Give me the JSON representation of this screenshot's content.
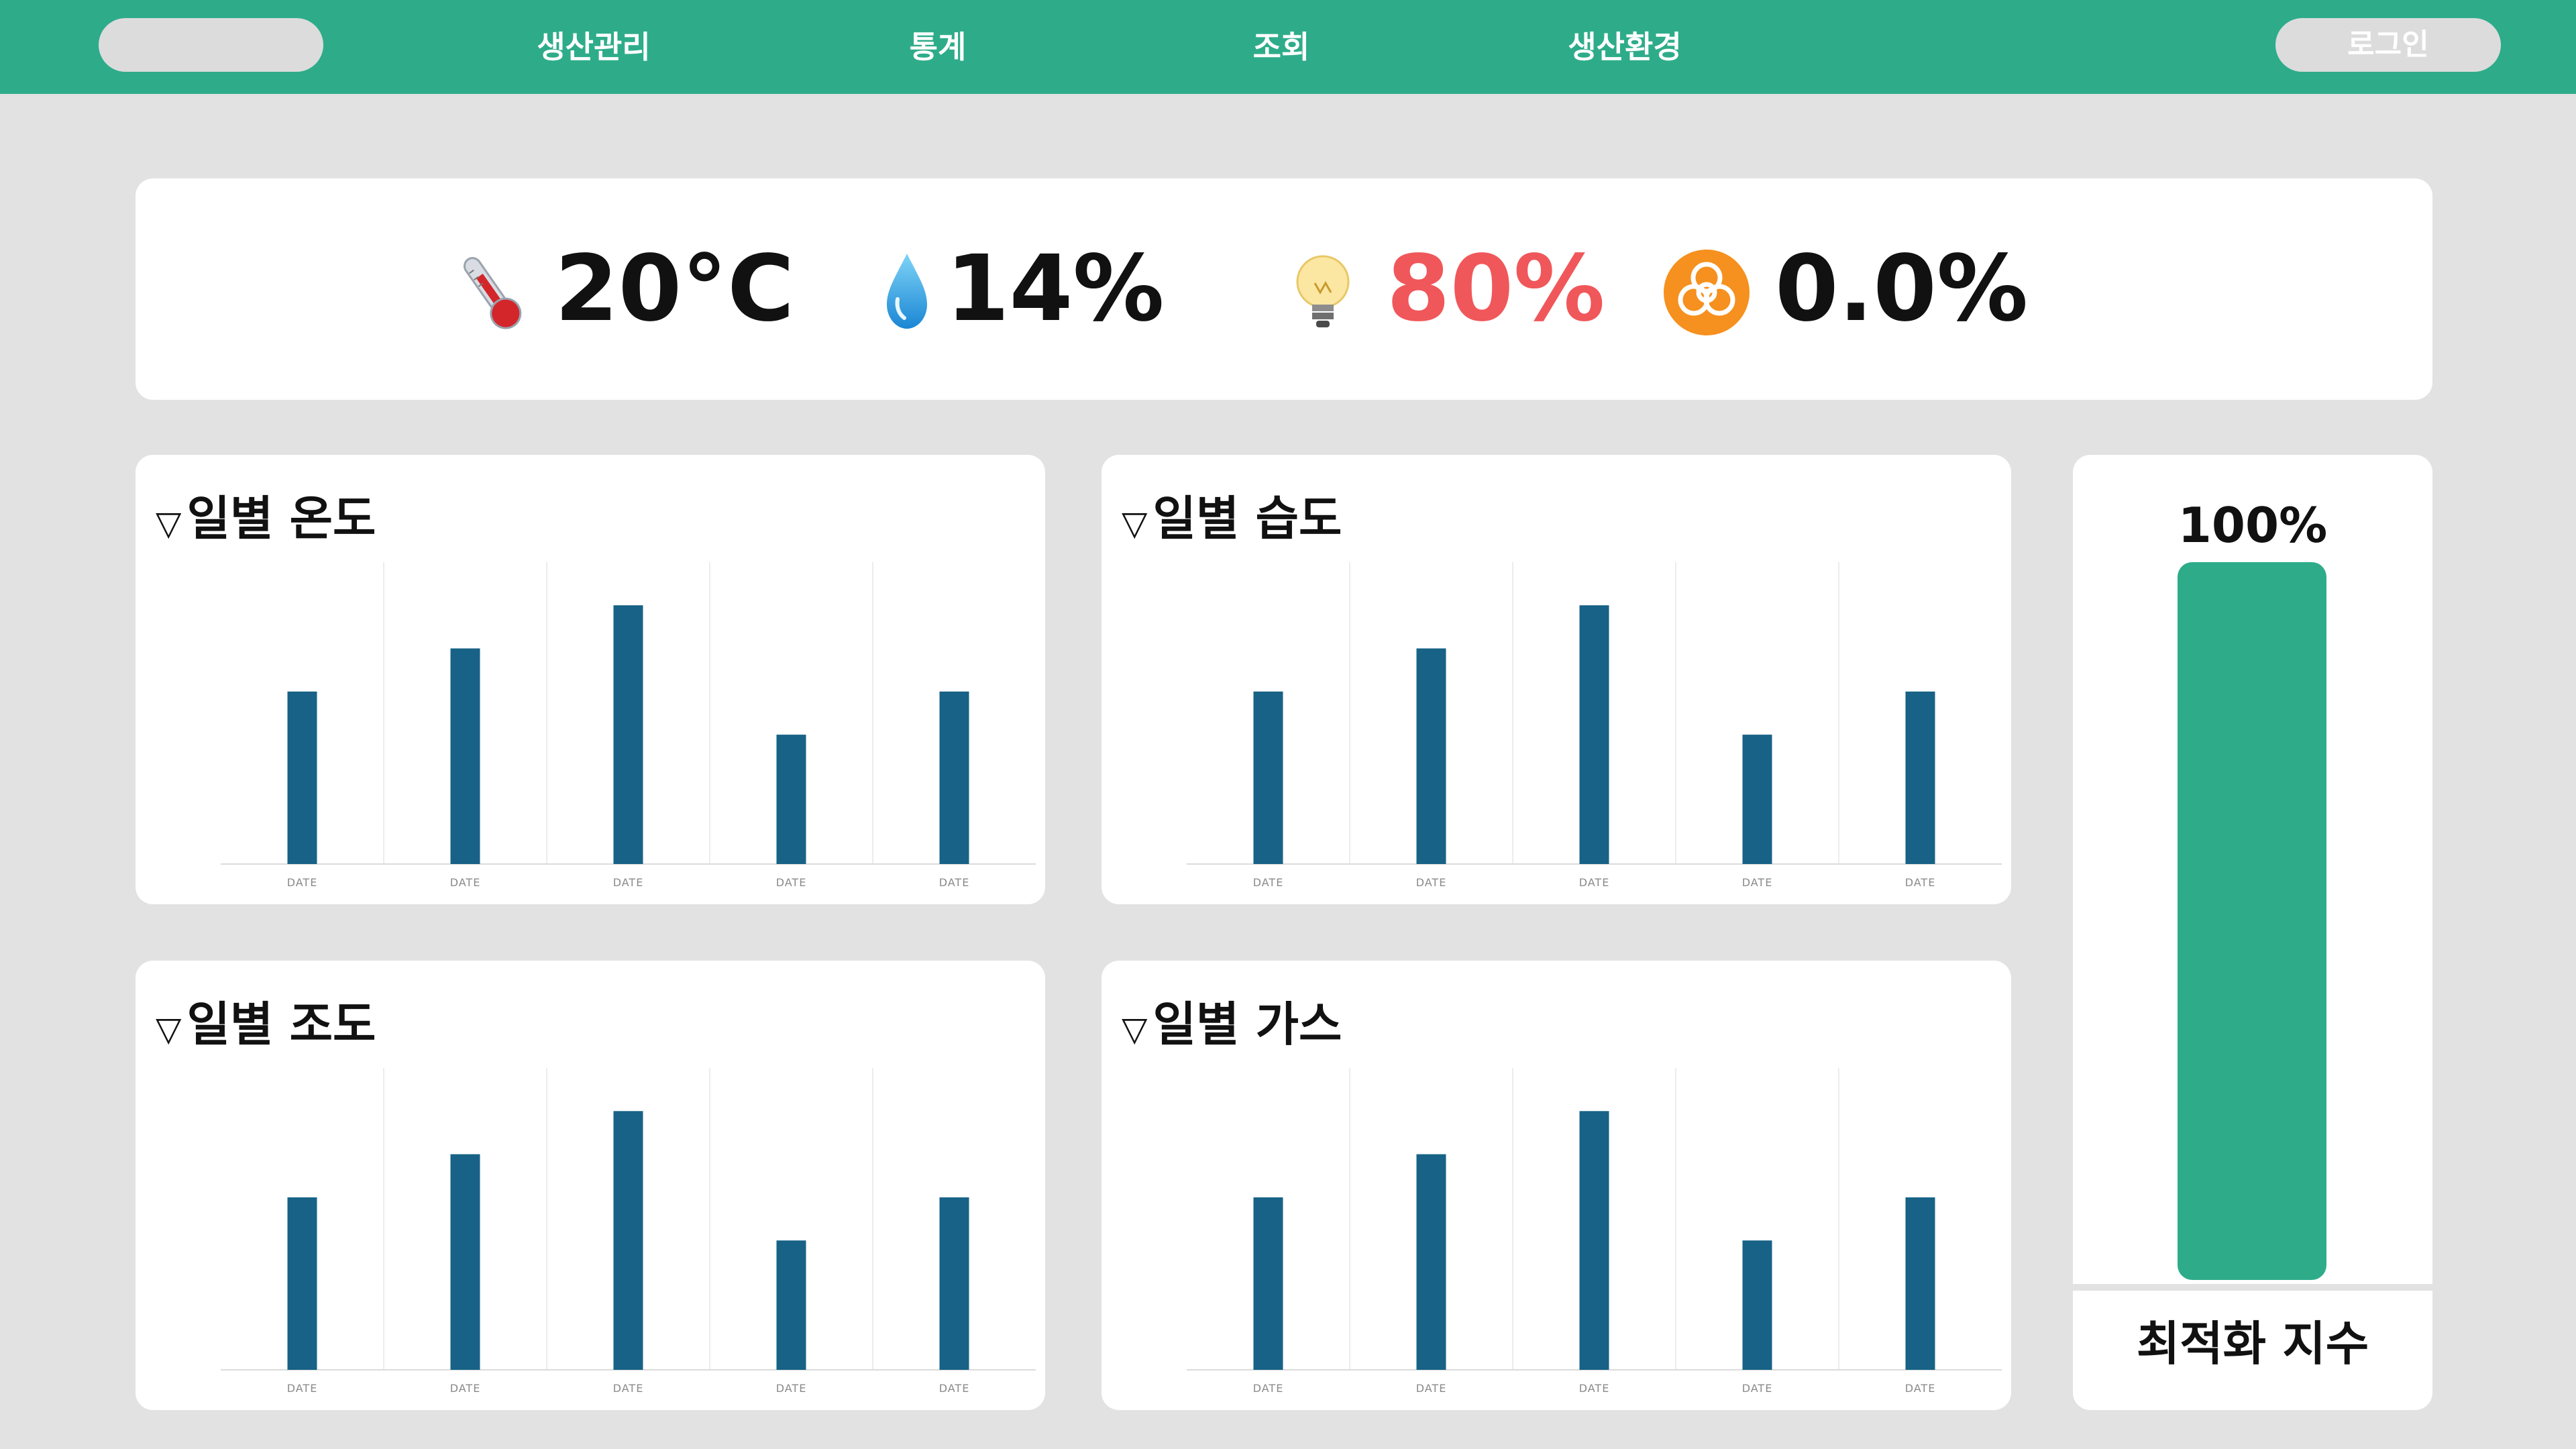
{
  "nav": {
    "items": [
      {
        "label": "생산관리"
      },
      {
        "label": "통계"
      },
      {
        "label": "조회"
      },
      {
        "label": "생산환경"
      }
    ],
    "login_label": "로그인"
  },
  "status": {
    "temperature": {
      "value": "20°C",
      "icon": "thermometer-icon",
      "color": "#111111"
    },
    "humidity": {
      "value": "14%",
      "icon": "water-drop-icon",
      "color": "#111111"
    },
    "light": {
      "value": "80%",
      "icon": "light-bulb-icon",
      "color": "#f0575a"
    },
    "gas": {
      "value": "0.0%",
      "icon": "biohazard-icon",
      "color": "#111111"
    }
  },
  "charts": [
    {
      "id": "temp",
      "title": "일별 온도"
    },
    {
      "id": "humid",
      "title": "일별 습도"
    },
    {
      "id": "illum",
      "title": "일별 조도"
    },
    {
      "id": "gas",
      "title": "일별 가스"
    }
  ],
  "chart_data": [
    {
      "type": "bar",
      "title": "일별 온도",
      "categories": [
        "DATE",
        "DATE",
        "DATE",
        "DATE",
        "DATE"
      ],
      "values": [
        4,
        5,
        6,
        3,
        4
      ],
      "ylim": [
        0,
        7
      ],
      "color": "#176286",
      "grid": true
    },
    {
      "type": "bar",
      "title": "일별 습도",
      "categories": [
        "DATE",
        "DATE",
        "DATE",
        "DATE",
        "DATE"
      ],
      "values": [
        4,
        5,
        6,
        3,
        4
      ],
      "ylim": [
        0,
        7
      ],
      "color": "#176286",
      "grid": true
    },
    {
      "type": "bar",
      "title": "일별 조도",
      "categories": [
        "DATE",
        "DATE",
        "DATE",
        "DATE",
        "DATE"
      ],
      "values": [
        4,
        5,
        6,
        3,
        4
      ],
      "ylim": [
        0,
        7
      ],
      "color": "#176286",
      "grid": true
    },
    {
      "type": "bar",
      "title": "일별 가스",
      "categories": [
        "DATE",
        "DATE",
        "DATE",
        "DATE",
        "DATE"
      ],
      "values": [
        4,
        5,
        6,
        3,
        4
      ],
      "ylim": [
        0,
        7
      ],
      "color": "#176286",
      "grid": true
    }
  ],
  "optimization": {
    "percent_label": "100%",
    "value": 1.0,
    "label": "최적화 지수",
    "color": "#2eac8a"
  },
  "colors": {
    "brand": "#2eac8a",
    "bar": "#176286",
    "alert": "#f0575a"
  }
}
